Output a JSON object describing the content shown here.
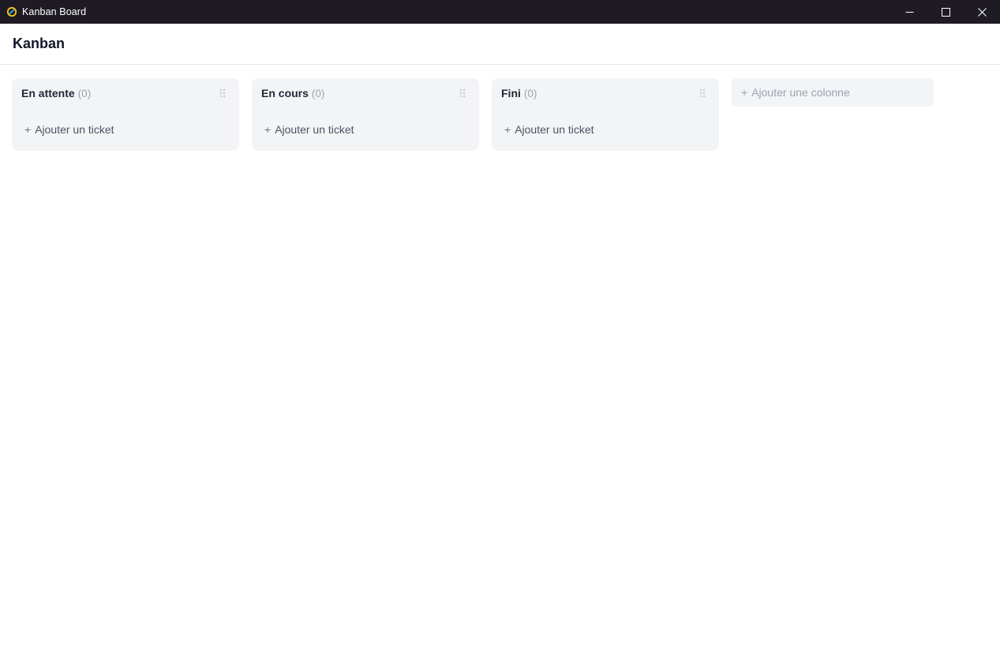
{
  "window": {
    "title": "Kanban Board",
    "icon": "app-logo-icon",
    "controls": [
      "minimize-icon",
      "maximize-icon",
      "close-icon"
    ]
  },
  "header": {
    "title": "Kanban"
  },
  "columns": [
    {
      "title": "En attente",
      "count": "(0)",
      "add_label": "Ajouter un ticket"
    },
    {
      "title": "En cours",
      "count": "(0)",
      "add_label": "Ajouter un ticket"
    },
    {
      "title": "Fini",
      "count": "(0)",
      "add_label": "Ajouter un ticket"
    }
  ],
  "add_column": {
    "label": "Ajouter une colonne"
  },
  "symbols": {
    "plus": "+"
  },
  "colors": {
    "titlebar": "#1f1b24",
    "column_bg": "#f3f4f6",
    "muted_text": "#9ca3af"
  }
}
